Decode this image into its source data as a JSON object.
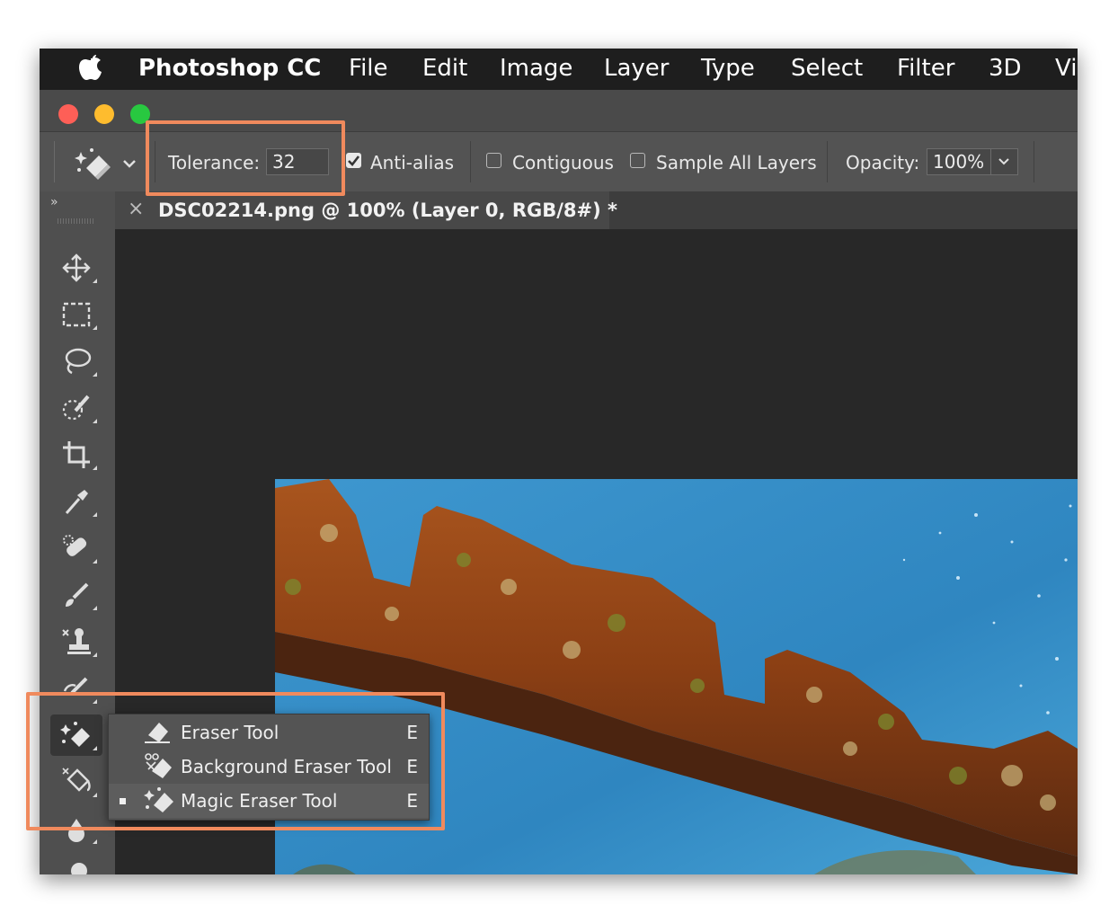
{
  "menubar": {
    "apple_icon": "apple-logo",
    "app_name": "Photoshop CC",
    "items": [
      "File",
      "Edit",
      "Image",
      "Layer",
      "Type",
      "Select",
      "Filter",
      "3D",
      "Vi"
    ]
  },
  "window": {
    "traffic_lights": {
      "close": "#fe5f57",
      "minimize": "#febc2e",
      "zoom": "#28c840"
    }
  },
  "options_bar": {
    "tool_preset_icon": "magic-eraser-icon",
    "tolerance_label": "Tolerance:",
    "tolerance_value": "32",
    "anti_alias_label": "Anti-alias",
    "anti_alias_checked": true,
    "contiguous_label": "Contiguous",
    "contiguous_checked": false,
    "sample_all_layers_label": "Sample All Layers",
    "sample_all_layers_checked": false,
    "opacity_label": "Opacity:",
    "opacity_value": "100%"
  },
  "document": {
    "tab_title": "DSC02214.png @ 100% (Layer 0, RGB/8#) *",
    "close_glyph": "×"
  },
  "tools": [
    "move-tool",
    "rectangular-marquee-tool",
    "lasso-tool",
    "quick-selection-tool",
    "crop-tool",
    "eyedropper-tool",
    "spot-healing-brush-tool",
    "brush-tool",
    "clone-stamp-tool",
    "history-brush-tool",
    "magic-eraser-tool",
    "paint-bucket-tool",
    "blur-tool",
    "dodge-tool"
  ],
  "flyout_menu": {
    "items": [
      {
        "label": "Eraser Tool",
        "shortcut": "E",
        "icon": "eraser-icon",
        "selected": false
      },
      {
        "label": "Background Eraser Tool",
        "shortcut": "E",
        "icon": "background-eraser-icon",
        "selected": false
      },
      {
        "label": "Magic Eraser Tool",
        "shortcut": "E",
        "icon": "magic-eraser-icon",
        "selected": true
      }
    ]
  },
  "colors": {
    "highlight": "#f08a5d",
    "panel": "#535353",
    "canvas": "#282828",
    "water": "#2f86c0"
  }
}
